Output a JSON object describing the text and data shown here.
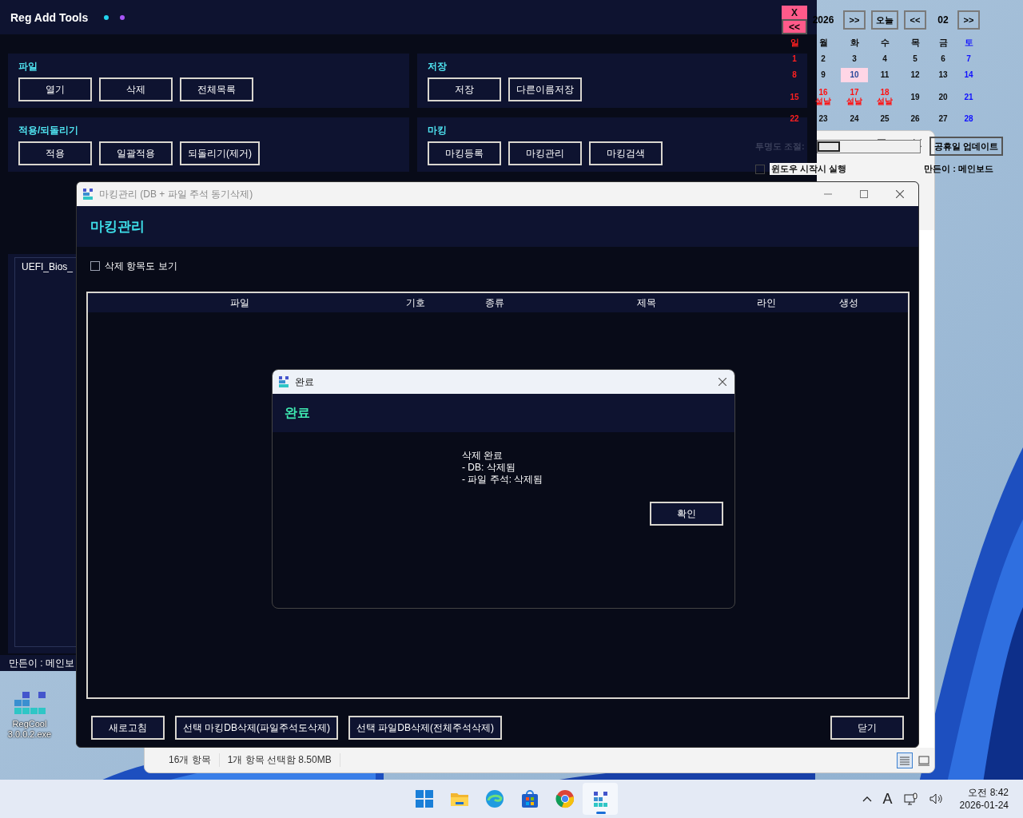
{
  "app": {
    "title": "Reg Add Tools",
    "status_dots": [
      {
        "color": "#22d3ee"
      },
      {
        "color": "#a855f7"
      }
    ],
    "groups": [
      {
        "label": "파일",
        "buttons": [
          "열기",
          "삭제",
          "전체목록"
        ]
      },
      {
        "label": "저장",
        "buttons": [
          "저장",
          "다른이름저장"
        ]
      },
      {
        "label": "적용/되돌리기",
        "buttons": [
          "적용",
          "일괄적용",
          "되돌리기(제거)"
        ]
      },
      {
        "label": "마킹",
        "buttons": [
          "마킹등록",
          "마킹관리",
          "마킹검색"
        ]
      }
    ],
    "list": {
      "items": [
        "UEFI_Bios_"
      ]
    },
    "footer": "만든이 : 메인보"
  },
  "calendar": {
    "close": "X",
    "prev_year": "<<",
    "year": "2026",
    "next_year": ">>",
    "today": "오늘",
    "prev_month": "<<",
    "month": "02",
    "next_month": ">>",
    "weekdays": [
      {
        "label": "일",
        "kind": "sunday"
      },
      {
        "label": "월",
        "kind": "weekday"
      },
      {
        "label": "화",
        "kind": "weekday"
      },
      {
        "label": "수",
        "kind": "weekday"
      },
      {
        "label": "목",
        "kind": "weekday"
      },
      {
        "label": "금",
        "kind": "weekday"
      },
      {
        "label": "토",
        "kind": "saturday"
      }
    ],
    "weeks": [
      [
        {
          "day": "1",
          "kind": "sunday",
          "selected": false
        },
        {
          "day": "2",
          "kind": "weekday",
          "selected": false
        },
        {
          "day": "3",
          "kind": "weekday",
          "selected": false
        },
        {
          "day": "4",
          "kind": "weekday",
          "selected": false
        },
        {
          "day": "5",
          "kind": "weekday",
          "selected": false
        },
        {
          "day": "6",
          "kind": "weekday",
          "selected": false
        },
        {
          "day": "7",
          "kind": "saturday",
          "selected": false
        }
      ],
      [
        {
          "day": "8",
          "kind": "sunday",
          "selected": false
        },
        {
          "day": "9",
          "kind": "weekday",
          "selected": false
        },
        {
          "day": "10",
          "kind": "weekday",
          "selected": true
        },
        {
          "day": "11",
          "kind": "weekday",
          "selected": false
        },
        {
          "day": "12",
          "kind": "weekday",
          "selected": false
        },
        {
          "day": "13",
          "kind": "weekday",
          "selected": false
        },
        {
          "day": "14",
          "kind": "saturday",
          "selected": false
        }
      ],
      [
        {
          "day": "15",
          "kind": "sunday",
          "selected": false
        },
        {
          "day": "16",
          "kind": "holiday",
          "note": "설날",
          "selected": false
        },
        {
          "day": "17",
          "kind": "holiday",
          "note": "설날",
          "selected": false
        },
        {
          "day": "18",
          "kind": "holiday",
          "note": "설날",
          "selected": false
        },
        {
          "day": "19",
          "kind": "weekday",
          "selected": false
        },
        {
          "day": "20",
          "kind": "weekday",
          "selected": false
        },
        {
          "day": "21",
          "kind": "saturday",
          "selected": false
        }
      ],
      [
        {
          "day": "22",
          "kind": "sunday",
          "selected": false
        },
        {
          "day": "23",
          "kind": "weekday",
          "selected": false
        },
        {
          "day": "24",
          "kind": "weekday",
          "selected": false
        },
        {
          "day": "25",
          "kind": "weekday",
          "selected": false
        },
        {
          "day": "26",
          "kind": "weekday",
          "selected": false
        },
        {
          "day": "27",
          "kind": "weekday",
          "selected": false
        },
        {
          "day": "28",
          "kind": "saturday",
          "selected": false
        }
      ]
    ],
    "opacity_label": "투명도 조절:",
    "opacity": {
      "level": 0
    },
    "holiday_update": "공휴일 업데이트",
    "autostart": {
      "label": "윈도우 시작시 실행",
      "checked": false
    },
    "author": "만든이 : 메인보드"
  },
  "explorer": {
    "status": [
      "16개 항목",
      "1개 항목 선택함 8.50MB"
    ]
  },
  "marking_window": {
    "title": "마킹관리 (DB + 파일 주석 동기삭제)",
    "heading": "마킹관리",
    "show_deleted": {
      "label": "삭제 항목도 보기",
      "checked": false
    },
    "table": {
      "columns": [
        "파일",
        "기호",
        "종류",
        "제목",
        "라인",
        "생성"
      ]
    },
    "buttons": [
      "새로고침",
      "선택 마킹DB삭제(파일주석도삭제)",
      "선택 파일DB삭제(전체주석삭제)"
    ],
    "close_button": "닫기"
  },
  "dialog": {
    "title": "완료",
    "heading": "완료",
    "message": [
      "삭제 완료",
      "- DB: 삭제됨",
      "- 파일 주석: 삭제됨"
    ],
    "ok": "확인"
  },
  "desktop_icons": [
    {
      "lines": [
        "RegCool",
        "3.0.0.2.exe"
      ]
    }
  ],
  "taskbar": {
    "apps": [
      {
        "kind": "start",
        "selected": false
      },
      {
        "kind": "folder",
        "selected": false
      },
      {
        "kind": "edge",
        "selected": false
      },
      {
        "kind": "store",
        "selected": false
      },
      {
        "kind": "chrome",
        "selected": false
      },
      {
        "kind": "regcool",
        "selected": true
      }
    ],
    "input_indicator": "A",
    "clock": {
      "time": "오전 8:42",
      "date": "2026-01-24"
    }
  }
}
